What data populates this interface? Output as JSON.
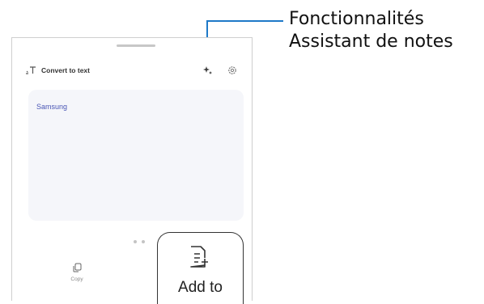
{
  "header": {
    "title": "Convert to text"
  },
  "content": {
    "text": "Samsung"
  },
  "actions": {
    "copy_label": "Copy",
    "add_to_label": "Add to"
  },
  "callout": {
    "line1": "Fonctionnalités",
    "line2": "Assistant de notes"
  },
  "colors": {
    "accent_text": "#4a56b5",
    "callout_line": "#1e79c8",
    "panel_bg": "#f5f6fa"
  },
  "icons": [
    "text-convert-icon",
    "ai-sparkle-icon",
    "settings-icon",
    "copy-icon",
    "add-note-icon"
  ]
}
